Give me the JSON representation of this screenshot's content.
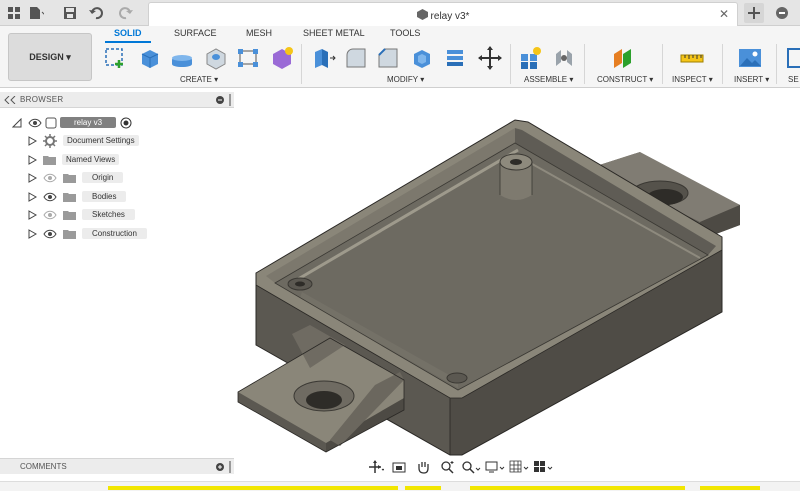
{
  "document": {
    "title": "relay v3*"
  },
  "workspace": {
    "label": "DESIGN",
    "arrow": "▾"
  },
  "ribbon": {
    "tabs": [
      "SOLID",
      "SURFACE",
      "MESH",
      "SHEET METAL",
      "TOOLS"
    ],
    "groups": [
      "CREATE ▾",
      "MODIFY ▾",
      "ASSEMBLE ▾",
      "CONSTRUCT ▾",
      "INSPECT ▾",
      "INSERT ▾",
      "SE"
    ]
  },
  "browser": {
    "title": "BROWSER",
    "root": "relay v3",
    "items": [
      "Document Settings",
      "Named Views",
      "Origin",
      "Bodies",
      "Sketches",
      "Construction"
    ]
  },
  "comments": {
    "title": "COMMENTS"
  },
  "colors": {
    "accent": "#0078d7",
    "model": "#6f6b63",
    "selection_strip": "#f2e600"
  }
}
